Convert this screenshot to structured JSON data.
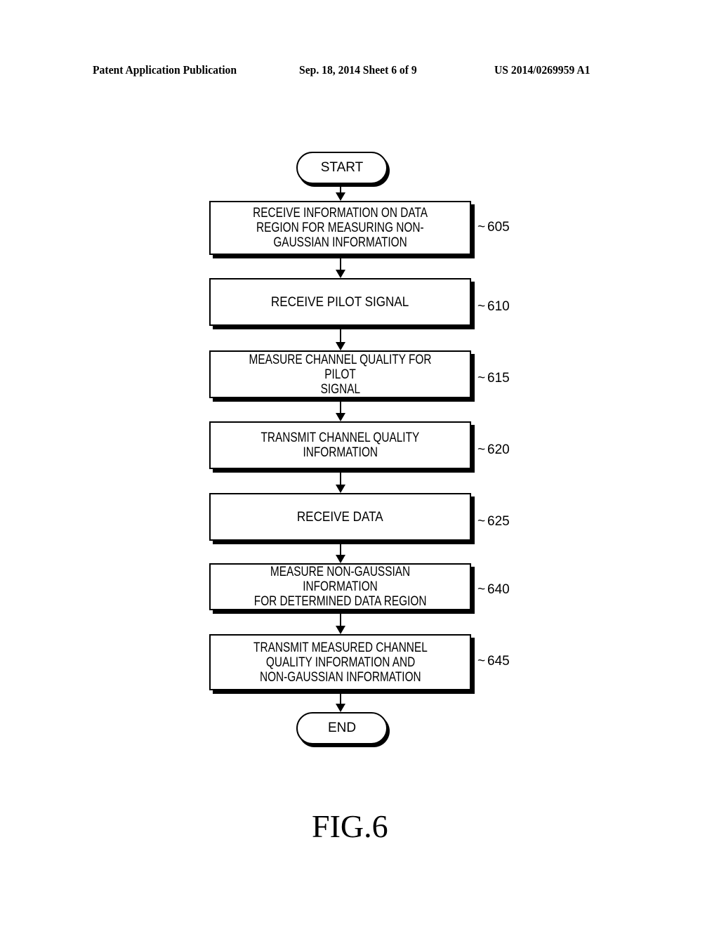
{
  "header": {
    "left": "Patent Application Publication",
    "center": "Sep. 18, 2014   Sheet 6 of 9",
    "right": "US 2014/0269959 A1"
  },
  "flowchart": {
    "start": "START",
    "end": "END",
    "steps": [
      {
        "ref": "605",
        "lines": [
          "RECEIVE INFORMATION ON DATA",
          "REGION FOR MEASURING NON-",
          "GAUSSIAN INFORMATION"
        ]
      },
      {
        "ref": "610",
        "lines": [
          "RECEIVE PILOT SIGNAL"
        ]
      },
      {
        "ref": "615",
        "lines": [
          "MEASURE CHANNEL QUALITY FOR PILOT",
          "SIGNAL"
        ]
      },
      {
        "ref": "620",
        "lines": [
          "TRANSMIT CHANNEL QUALITY",
          "INFORMATION"
        ]
      },
      {
        "ref": "625",
        "lines": [
          "RECEIVE DATA"
        ]
      },
      {
        "ref": "640",
        "lines": [
          "MEASURE NON-GAUSSIAN INFORMATION",
          "FOR DETERMINED DATA REGION"
        ]
      },
      {
        "ref": "645",
        "lines": [
          "TRANSMIT MEASURED CHANNEL",
          "QUALITY INFORMATION AND",
          "NON-GAUSSIAN INFORMATION"
        ]
      }
    ]
  },
  "figure_label": "FIG.6"
}
